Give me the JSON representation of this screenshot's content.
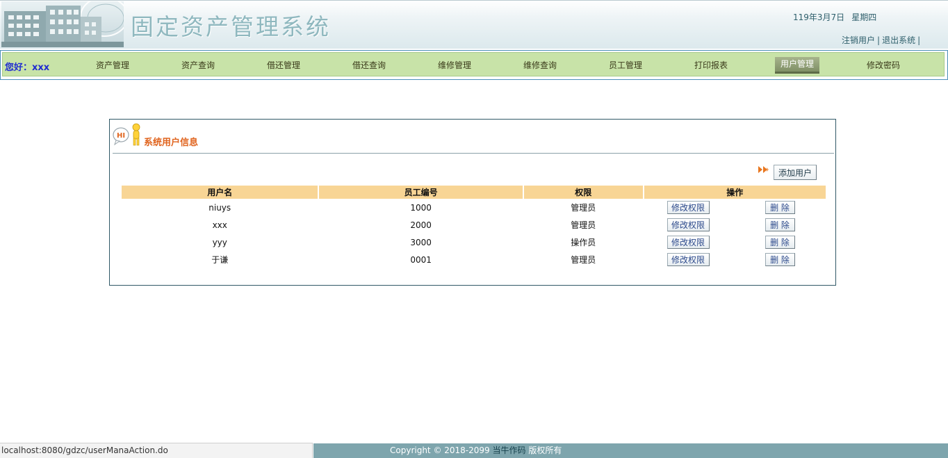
{
  "header": {
    "title": "固定资产管理系统",
    "date": "119年3月7日",
    "weekday": "星期四",
    "links": {
      "logout_user": "注销用户",
      "exit_system": "退出系统",
      "separator": "|"
    }
  },
  "nav": {
    "greeting": "您好：xxx",
    "items": [
      "资产管理",
      "资产查询",
      "借还管理",
      "借还查询",
      "维修管理",
      "维修查询",
      "员工管理",
      "打印报表",
      "用户管理",
      "修改密码"
    ],
    "active_index": 8
  },
  "panel": {
    "icon_text": "HI",
    "title": "系统用户信息",
    "add_button": "添加用户",
    "columns": [
      "用户名",
      "员工编号",
      "权限",
      "操作"
    ],
    "rows": [
      {
        "username": "niuys",
        "employee_no": "1000",
        "role": "管理员"
      },
      {
        "username": "xxx",
        "employee_no": "2000",
        "role": "管理员"
      },
      {
        "username": "yyy",
        "employee_no": "3000",
        "role": "操作员"
      },
      {
        "username": "于谦",
        "employee_no": "0001",
        "role": "管理员"
      }
    ],
    "edit_label": "修改权限",
    "delete_label": "删 除"
  },
  "statusbar": {
    "url": "localhost:8080/gdzc/userManaAction.do"
  },
  "footer": {
    "copyright_prefix": "Copyright © 2018-2099",
    "brand": "当牛作码",
    "suffix": "版权所有"
  },
  "colors": {
    "nav_bg": "#c8e3a8",
    "table_header_bg": "#f8d595",
    "panel_title": "#e0641e",
    "footer_bg": "#7ea5ad",
    "greeting": "#1f2bd1"
  }
}
